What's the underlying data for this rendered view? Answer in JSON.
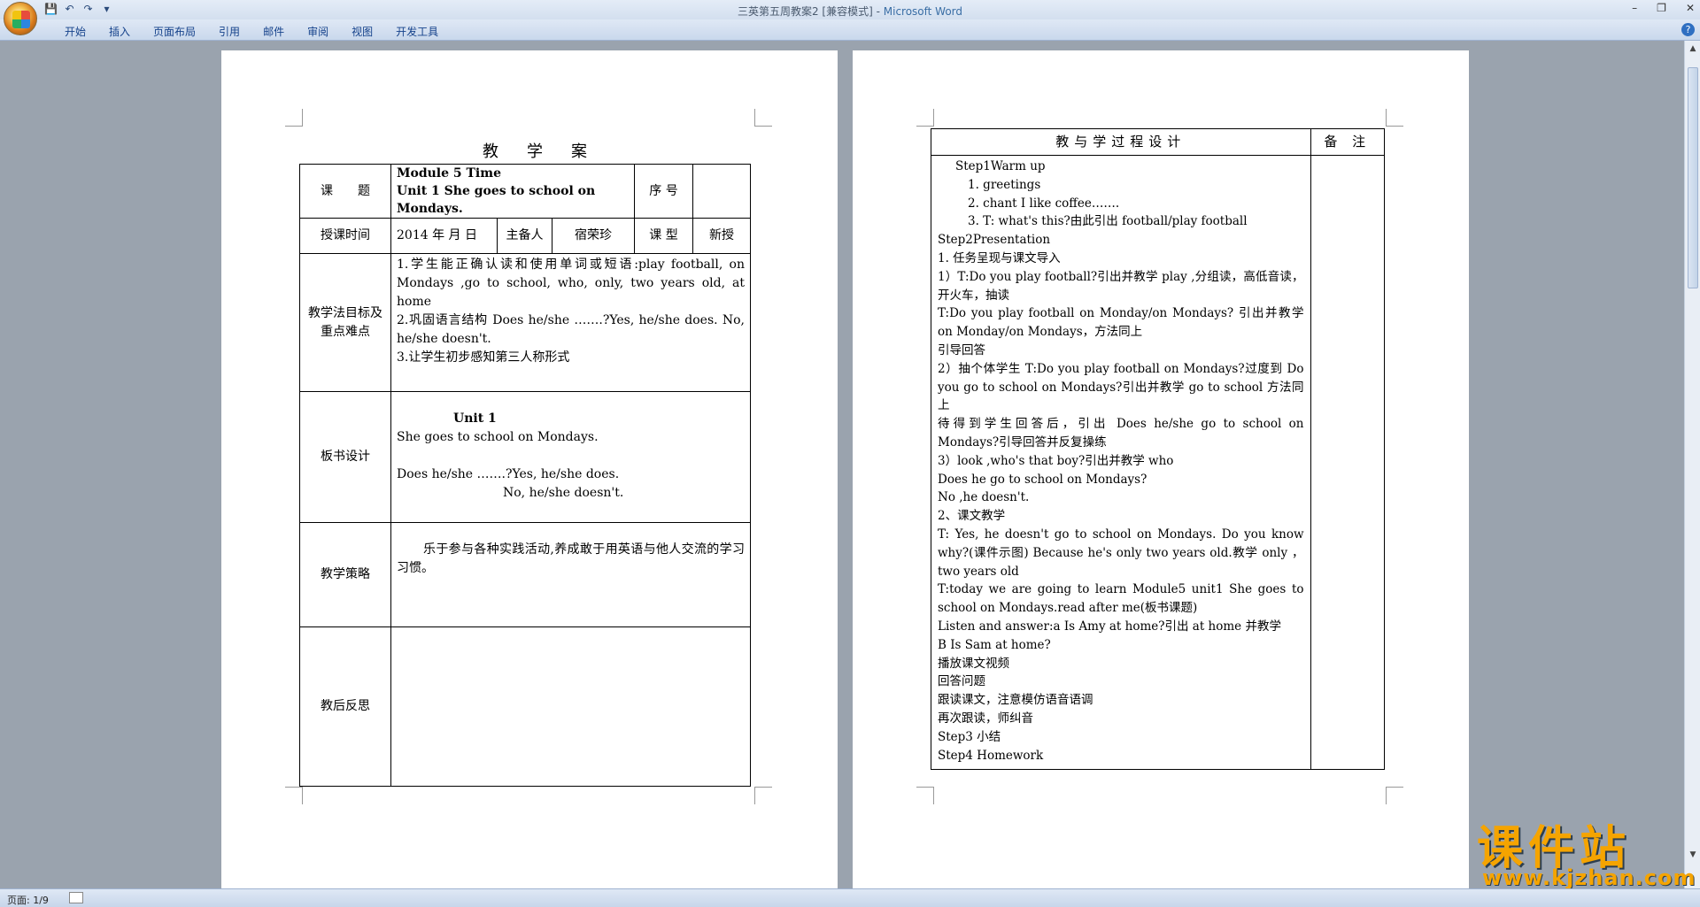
{
  "window": {
    "title_doc": "三英第五周教案2 [兼容模式]",
    "title_sep": " - ",
    "title_app": "Microsoft Word"
  },
  "ribbon": {
    "tabs": [
      "开始",
      "插入",
      "页面布局",
      "引用",
      "邮件",
      "审阅",
      "视图",
      "开发工具"
    ]
  },
  "statusbar": {
    "page": "页面: 1/9"
  },
  "watermark": {
    "name": "课件站",
    "url": "www.kjzhan.com"
  },
  "page1": {
    "doc_title": "教学案",
    "rows": {
      "topic_label": "课　　题",
      "topic_line1": "Module 5 Time",
      "topic_line2": "Unit 1 She goes to school on Mondays.",
      "seq_label": "序 号",
      "time_label": "授课时间",
      "time_value": "2014 年  月  日",
      "preparer_label": "主备人",
      "preparer_value": "宿荣珍",
      "type_label": "课 型",
      "type_value": "新授",
      "goals_label": "教学法目标及重点难点",
      "goals": [
        "1.学生能正确认读和使用单词或短语:play football, on Mondays ,go to school, who, only, two years old, at home",
        "2.巩固语言结构 Does he/she …….?Yes, he/she does. No, he/she doesn't.",
        "3.让学生初步感知第三人称形式"
      ],
      "board_label": "板书设计",
      "board_title": "Unit 1",
      "board_line1": "She goes to school on Mondays.",
      "board_line2": "Does he/she …….?Yes, he/she does.",
      "board_line3": "No, he/she doesn't.",
      "strategy_label": "教学策略",
      "strategy_text": "乐于参与各种实践活动,养成敢于用英语与他人交流的学习习惯。",
      "reflection_label": "教后反思"
    }
  },
  "page2": {
    "header_process": "教与学过程设计",
    "header_notes": "备 注",
    "lines": [
      "Step1Warm  up",
      "1.   greetings",
      "2.   chant I like coffee…….",
      "3.   T: what's this?由此引出 football/play football",
      "Step2Presentation",
      "1. 任务呈现与课文导入",
      "1）T:Do you play football?引出并教学 play ,分组读，高低音读，开火车，抽读",
      "T:Do you play football on Monday/on Mondays? 引出并教学 on Monday/on Mondays，方法同上",
      "引导回答",
      "2）抽个体学生 T:Do you play football on Mondays?过度到 Do you go to school on Mondays?引出并教学 go to school 方法同上",
      "待得到学生回答后，引出 Does he/she go to school on Mondays?引导回答并反复操练",
      "3）look ,who's that boy?引出并教学 who",
      "Does he go to school on Mondays?",
      "No ,he doesn't.",
      "2、课文教学",
      "T: Yes, he doesn't go to school on Mondays. Do you know why?(课件示图) Because he's only two years old.教学 only ，two years old",
      "T:today we are going to learn Module5 unit1 She goes to school on Mondays.read after me(板书课题)",
      "Listen and answer:a Is Amy at home?引出 at home 并教学",
      "B Is Sam at home?",
      "播放课文视频",
      "回答问题",
      "跟读课文，注意模仿语音语调",
      "再次跟读，师纠音",
      "Step3 小结",
      "Step4 Homework"
    ]
  }
}
